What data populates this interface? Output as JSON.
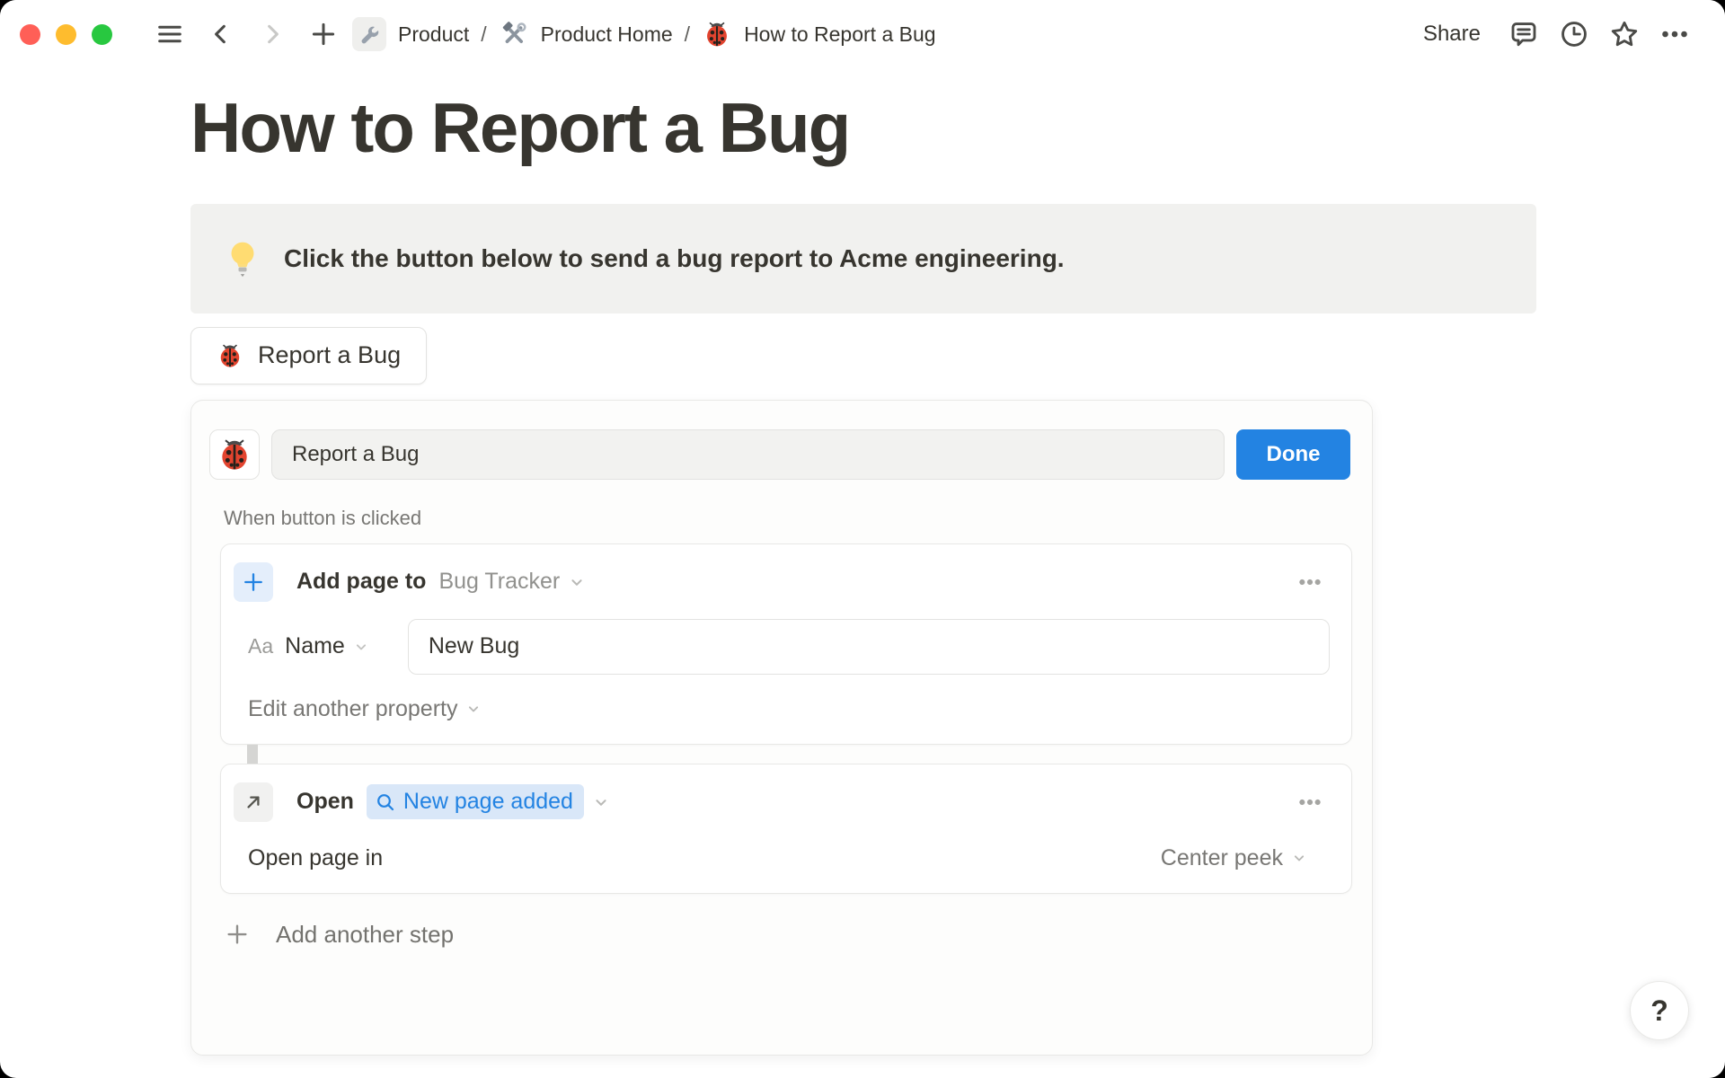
{
  "chrome": {
    "share_label": "Share",
    "icons": [
      "sidebar-menu",
      "back",
      "forward",
      "new-page",
      "comments",
      "history",
      "favorite",
      "more-options"
    ]
  },
  "breadcrumb": {
    "divider": "/",
    "items": [
      {
        "icon": "wrench",
        "label": "Product"
      },
      {
        "icon": "hammer-and-wrench",
        "label": "Product Home"
      },
      {
        "icon": "ladybug",
        "label": "How to Report a Bug"
      }
    ]
  },
  "content": {
    "title": "How to Report a Bug",
    "callout": {
      "icon": "lightbulb",
      "text": "Click the button below to send a bug report to Acme engineering."
    },
    "bug_button": {
      "icon": "ladybug",
      "label": "Report a Bug"
    }
  },
  "button_editor": {
    "icon": "ladybug",
    "name_value": "Report a Bug",
    "done_label": "Done",
    "trigger_label": "When button is clicked",
    "step1": {
      "icon": "plus",
      "action_label": "Add page to",
      "target_value": "Bug Tracker",
      "property_type": "Aa",
      "property_label": "Name",
      "property_value": "New Bug",
      "edit_property_label": "Edit another property"
    },
    "step2": {
      "icon": "arrow-up-right",
      "action_label": "Open",
      "target_icon": "search",
      "target_value": "New page added",
      "row_label": "Open page in",
      "row_value": "Center peek"
    },
    "add_step_label": "Add another step"
  },
  "help_label": "?",
  "colors": {
    "accent_blue": "#2383E2",
    "pill_bg": "#D9E7F8",
    "plus_badge_bg": "#E4EEFB",
    "callout_bg": "#F1F1EF",
    "traffic_red": "#FF5F57",
    "traffic_yellow": "#FEBC2E",
    "traffic_green": "#28C840"
  }
}
